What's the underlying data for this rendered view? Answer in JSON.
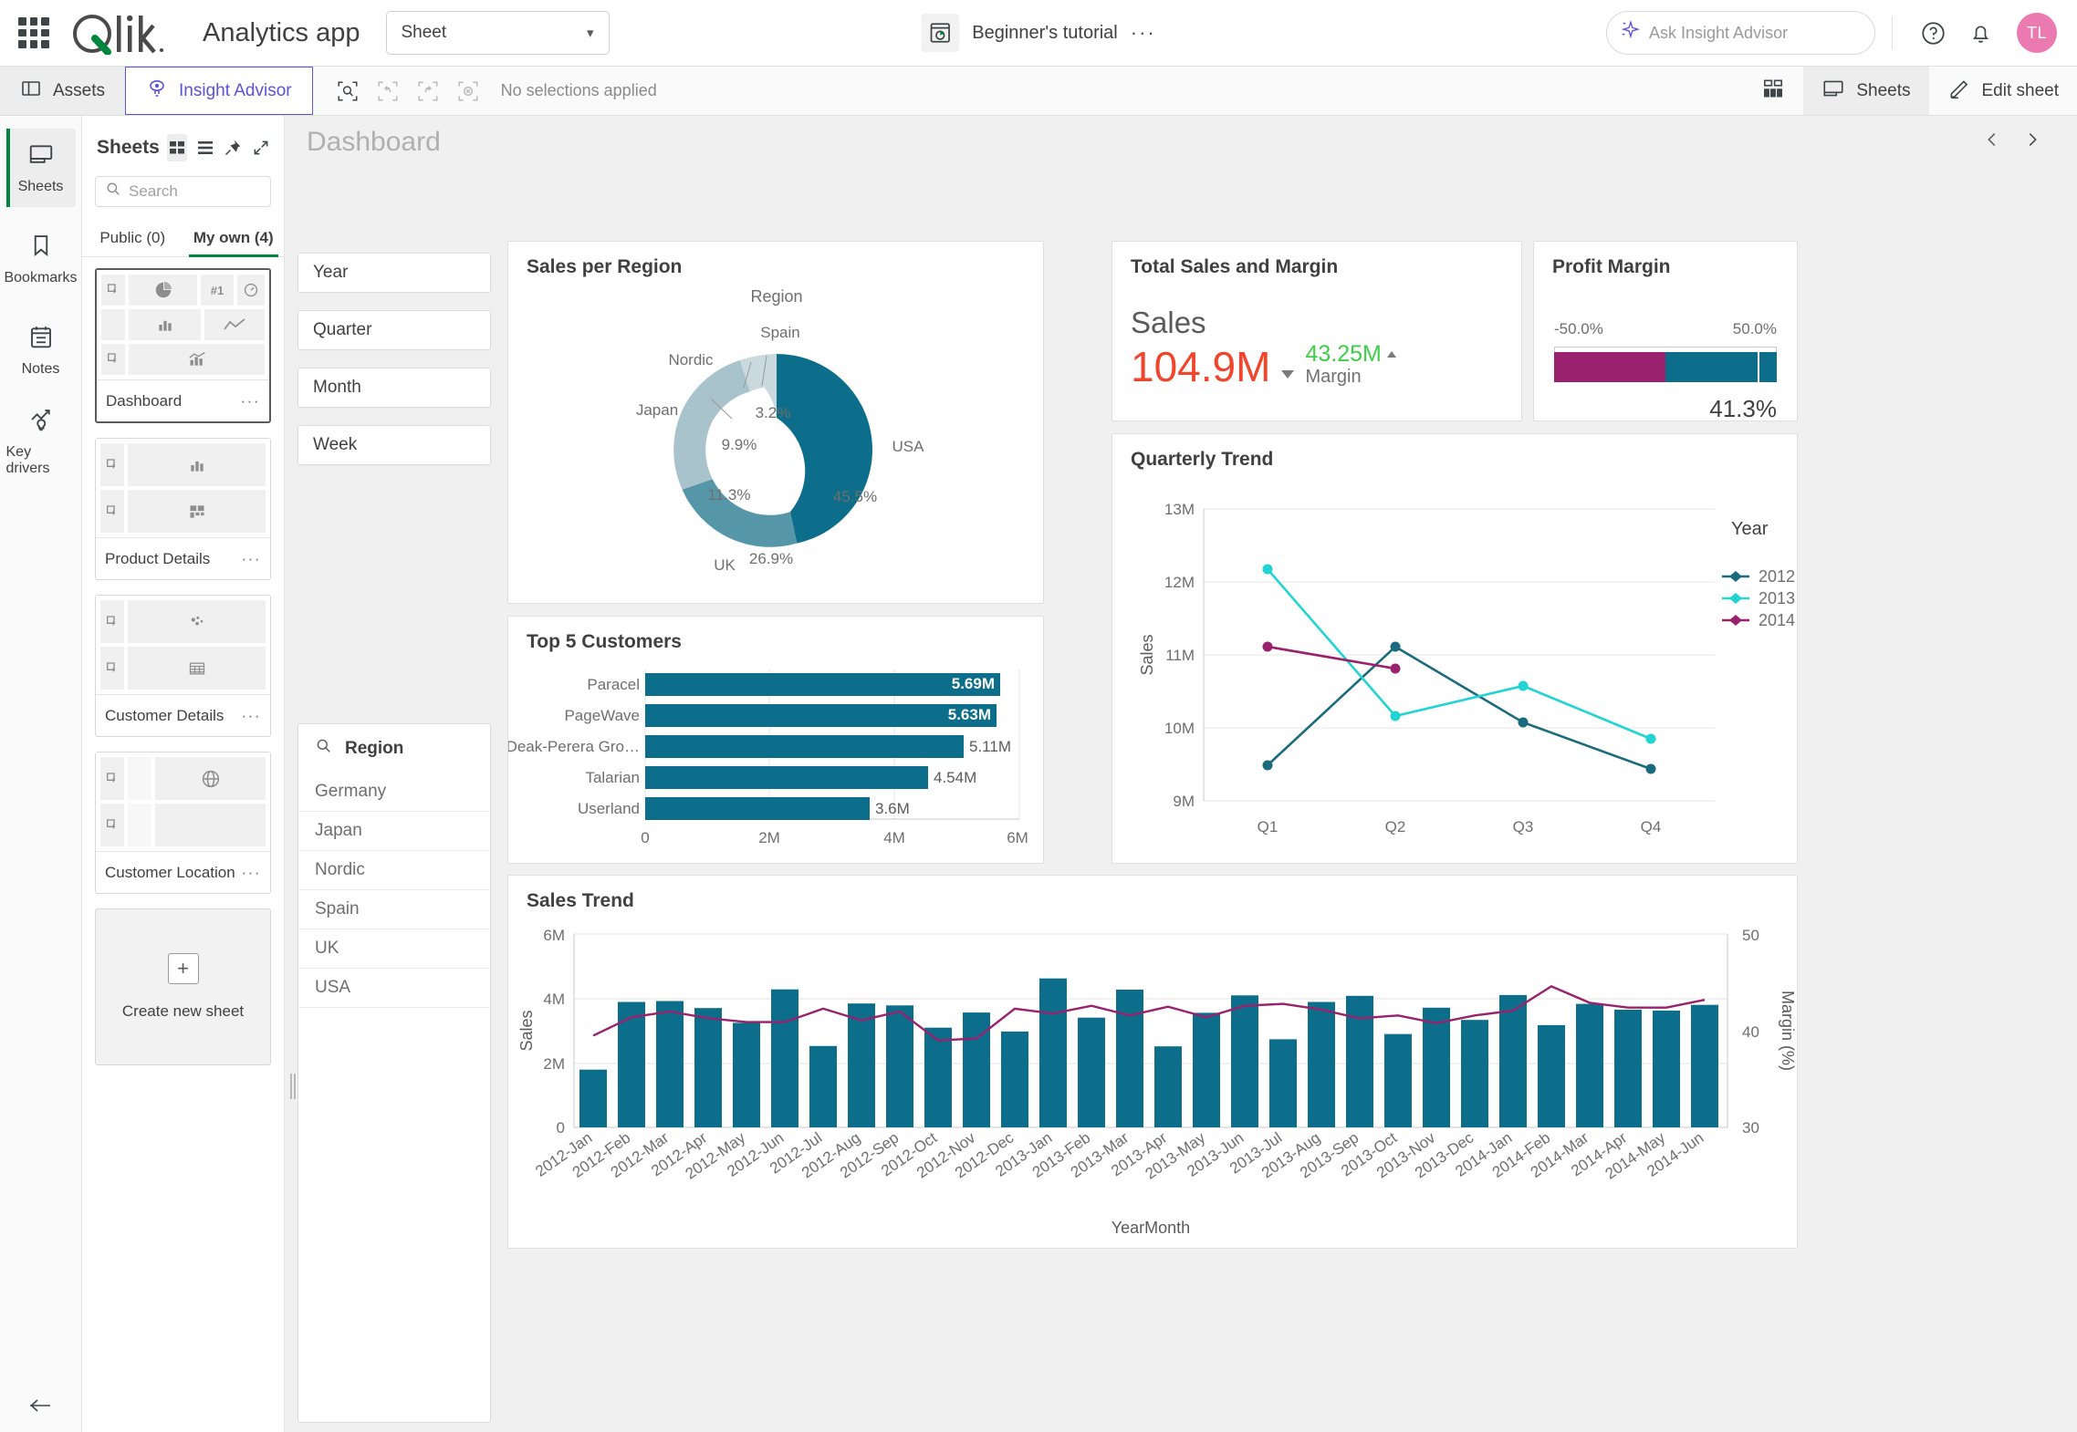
{
  "topbar": {
    "app_title": "Analytics app",
    "sheet_selector": "Sheet",
    "center_title": "Beginner's tutorial",
    "center_dots": "···",
    "ask_placeholder": "Ask Insight Advisor",
    "ask_value": "",
    "avatar_initials": "TL"
  },
  "subbar": {
    "assets": "Assets",
    "insight_advisor": "Insight Advisor",
    "no_selections": "No selections applied",
    "sheets": "Sheets",
    "edit_sheet": "Edit sheet"
  },
  "rail": {
    "items": [
      {
        "label": "Sheets",
        "icon": "sheet-icon"
      },
      {
        "label": "Bookmarks",
        "icon": "bookmark-icon"
      },
      {
        "label": "Notes",
        "icon": "notes-icon"
      },
      {
        "label": "Key drivers",
        "icon": "key-drivers-icon"
      }
    ]
  },
  "sheets_panel": {
    "title": "Sheets",
    "search_placeholder": "Search",
    "search_value": "",
    "tabs": [
      {
        "label": "Public (0)",
        "active": false
      },
      {
        "label": "My own (4)",
        "active": true
      }
    ],
    "cards": [
      {
        "name": "Dashboard",
        "selected": true,
        "dots": "···"
      },
      {
        "name": "Product Details",
        "selected": false,
        "dots": "···"
      },
      {
        "name": "Customer Details",
        "selected": false,
        "dots": "···"
      },
      {
        "name": "Customer Location",
        "selected": false,
        "dots": "···"
      }
    ],
    "create_new": {
      "plus": "+",
      "label": "Create new sheet"
    }
  },
  "main": {
    "dashboard_title": "Dashboard",
    "filters": [
      "Year",
      "Quarter",
      "Month",
      "Week"
    ],
    "region_listbox": {
      "title": "Region",
      "items": [
        "Germany",
        "Japan",
        "Nordic",
        "Spain",
        "UK",
        "USA"
      ]
    },
    "kpi": {
      "title": "Total Sales and Margin",
      "measure_label": "Sales",
      "value": "104.9M",
      "secondary_value": "43.25M",
      "secondary_label": "Margin"
    },
    "gauge": {
      "title": "Profit Margin",
      "min_label": "-50.0%",
      "max_label": "50.0%",
      "value_label": "41.3%"
    }
  },
  "colors": {
    "teal": "#197b96",
    "teal_dark": "#0f6a83",
    "magenta": "#99216e",
    "cyan": "#21d3d3",
    "navy": "#1a6b7d",
    "green": "#00873d",
    "orange_red": "#f0462d",
    "purple": "#5b52d9"
  },
  "chart_data": [
    {
      "type": "pie",
      "id": "sales-per-region",
      "title": "Sales per Region",
      "legend_title": "Region",
      "donut": true,
      "categories": [
        "USA",
        "UK",
        "Japan",
        "Nordic",
        "Spain"
      ],
      "values": [
        45.5,
        26.9,
        11.3,
        9.9,
        3.2
      ],
      "labels": [
        "45.5%",
        "26.9%",
        "11.3%",
        "9.9%",
        "3.2%"
      ],
      "colors": [
        "#0c6e8a",
        "#5596a8",
        "#a8c3cc",
        "#a8c3cc",
        "#c9d9de"
      ]
    },
    {
      "type": "bar",
      "id": "top-5-customers",
      "title": "Top 5 Customers",
      "orientation": "horizontal",
      "categories": [
        "Paracel",
        "PageWave",
        "Deak-Perera Gro…",
        "Talarian",
        "Userland"
      ],
      "values": [
        5.69,
        5.63,
        5.11,
        4.54,
        3.6
      ],
      "value_labels": [
        "5.69M",
        "5.63M",
        "5.11M",
        "4.54M",
        "3.6M"
      ],
      "xlabel": "",
      "ylabel": "",
      "xticks": [
        "0",
        "2M",
        "4M",
        "6M"
      ],
      "xlim": [
        0,
        6
      ],
      "bar_color": "#0c6e8a"
    },
    {
      "type": "line",
      "id": "quarterly-trend",
      "title": "Quarterly Trend",
      "legend_title": "Year",
      "legend_position": "right",
      "categories": [
        "Q1",
        "Q2",
        "Q3",
        "Q4"
      ],
      "ylabel": "Sales",
      "xlabel": "",
      "ylim": [
        9,
        13
      ],
      "yticks": [
        "9M",
        "10M",
        "11M",
        "12M",
        "13M"
      ],
      "series": [
        {
          "name": "2012",
          "color": "#1a6b7d",
          "values": [
            9.48,
            11.11,
            10.07,
            9.43
          ]
        },
        {
          "name": "2013",
          "color": "#21d3d3",
          "values": [
            12.17,
            10.16,
            10.57,
            9.85
          ]
        },
        {
          "name": "2014",
          "color": "#99216e",
          "values": [
            11.11,
            10.81,
            null,
            null
          ]
        }
      ]
    },
    {
      "type": "bar",
      "id": "sales-trend",
      "title": "Sales Trend",
      "xlabel": "YearMonth",
      "ylabel": "Sales",
      "y2label": "Margin (%)",
      "yticks": [
        "0",
        "2M",
        "4M",
        "6M"
      ],
      "ylim": [
        0,
        6
      ],
      "y2ticks": [
        "30",
        "40",
        "50"
      ],
      "y2lim": [
        30,
        50
      ],
      "bar_color": "#0c6e8a",
      "line_color": "#99216e",
      "categories": [
        "2012-Jan",
        "2012-Feb",
        "2012-Mar",
        "2012-Apr",
        "2012-May",
        "2012-Jun",
        "2012-Jul",
        "2012-Aug",
        "2012-Sep",
        "2012-Oct",
        "2012-Nov",
        "2012-Dec",
        "2013-Jan",
        "2013-Feb",
        "2013-Mar",
        "2013-Apr",
        "2013-May",
        "2013-Jun",
        "2013-Jul",
        "2013-Aug",
        "2013-Sep",
        "2013-Oct",
        "2013-Nov",
        "2013-Dec",
        "2014-Jan",
        "2014-Feb",
        "2014-Mar",
        "2014-Apr",
        "2014-May",
        "2014-Jun"
      ],
      "series": [
        {
          "name": "Sales",
          "type": "bar",
          "values": [
            1.82,
            3.9,
            3.93,
            3.71,
            3.25,
            4.29,
            2.53,
            3.85,
            3.79,
            3.1,
            3.57,
            2.98,
            4.63,
            3.4,
            4.28,
            2.52,
            3.56,
            4.1,
            2.72,
            3.9,
            4.09,
            2.9,
            3.72,
            3.34,
            4.11,
            3.17,
            3.83,
            3.65,
            3.62,
            3.8
          ]
        },
        {
          "name": "Margin",
          "type": "line",
          "axis": "y2",
          "values": [
            39.5,
            41.4,
            42.0,
            41.3,
            40.9,
            40.9,
            42.3,
            41.1,
            42.0,
            39.6,
            39.8,
            42.9,
            42.4,
            43.2,
            42.2,
            43.1,
            42.0,
            43.2,
            43.4,
            42.8,
            41.9,
            42.2,
            41.4,
            42.2,
            42.7,
            45.2,
            43.5,
            43.0,
            43.0,
            43.8
          ]
        }
      ]
    }
  ]
}
